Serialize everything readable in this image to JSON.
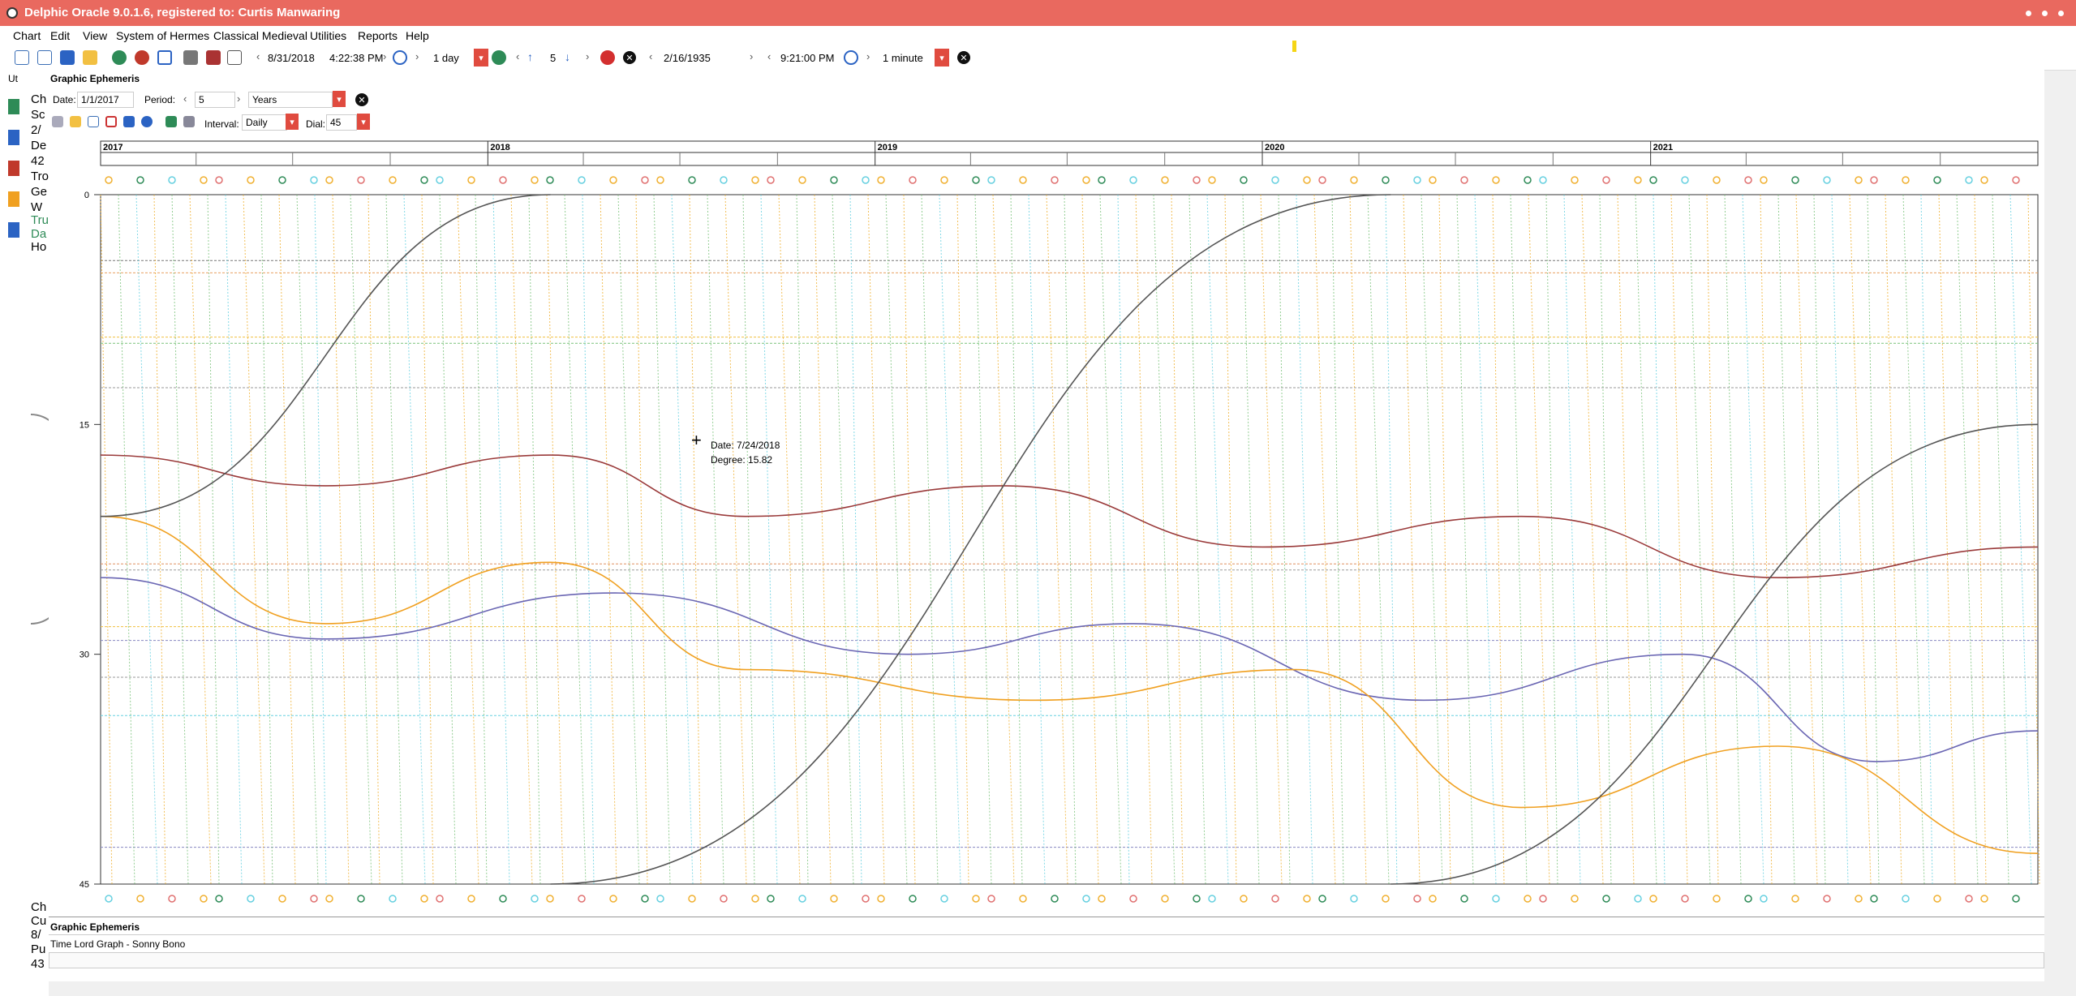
{
  "window": {
    "title": "Delphic Oracle 9.0.1.6, registered to: Curtis Manwaring"
  },
  "menu": [
    "Chart",
    "Edit",
    "View",
    "System of Hermes",
    "Classical Medieval",
    "Utilities",
    "Reports",
    "Help"
  ],
  "toolbar": {
    "date": "8/31/2018",
    "time": "4:22:38 PM",
    "step": "1 day",
    "step_count": "5",
    "date2": "2/16/1935",
    "time2": "9:21:00 PM",
    "step2": "1 minute"
  },
  "ephemeris": {
    "header": "Graphic Ephemeris",
    "date_label": "Date:",
    "date_value": "1/1/2017",
    "period_label": "Period:",
    "period_value": "5",
    "period_unit": "Years",
    "interval_label": "Interval:",
    "interval_value": "Daily",
    "dial_label": "Dial:",
    "dial_value": "45"
  },
  "left_panel_text": [
    "Ut",
    "Ch",
    "Sc",
    "2/",
    "De",
    "42",
    "Tro",
    "Ge",
    "W",
    "Tru",
    "Da",
    "Ho"
  ],
  "left_panel_bottom": [
    "Ch",
    "Cu",
    "8/",
    "Pu",
    "43"
  ],
  "tooltip": {
    "date": "Date: 7/24/2018",
    "degree": "Degree: 15.82"
  },
  "bottom_tabs": {
    "tab1": "Graphic Ephemeris",
    "tab2": "Time Lord Graph - Sonny Bono"
  },
  "chart_data": {
    "type": "line",
    "title": "",
    "x_years": [
      "2017",
      "2018",
      "2019",
      "2020",
      "2021"
    ],
    "x_range": [
      "2017-01-01",
      "2022-01-01"
    ],
    "y_ticks": [
      0,
      15,
      30,
      45
    ],
    "ylim": [
      0,
      45
    ],
    "y_inverted": true,
    "series": [
      {
        "color": "#9a3a3a",
        "x": [
          "2017-01-01",
          "2017-08-01",
          "2018-03-01",
          "2018-09-01",
          "2019-05-01",
          "2020-01-01",
          "2020-09-01",
          "2021-05-01",
          "2022-01-01"
        ],
        "values": [
          17,
          19,
          17,
          21,
          19,
          23,
          21,
          25,
          23
        ]
      },
      {
        "color": "#6a66b3",
        "x": [
          "2017-01-01",
          "2017-08-01",
          "2018-05-01",
          "2019-02-01",
          "2019-09-01",
          "2020-06-01",
          "2021-02-01",
          "2021-08-01",
          "2022-01-01"
        ],
        "values": [
          25,
          29,
          26,
          30,
          28,
          33,
          30,
          37,
          35
        ]
      },
      {
        "color": "#f0a020",
        "x": [
          "2017-01-01",
          "2017-08-01",
          "2018-03-01",
          "2018-09-01",
          "2019-06-01",
          "2020-02-01",
          "2020-09-01",
          "2021-05-01",
          "2022-01-01"
        ],
        "values": [
          21,
          28,
          24,
          31,
          33,
          31,
          40,
          36,
          43
        ]
      },
      {
        "color": "#555555",
        "x": [
          "2017-01-01",
          "2018-03-01"
        ],
        "values": [
          21,
          0
        ]
      },
      {
        "color": "#555555",
        "x": [
          "2018-03-01",
          "2020-05-01"
        ],
        "values": [
          45,
          0
        ]
      },
      {
        "color": "#555555",
        "x": [
          "2020-05-01",
          "2022-01-01"
        ],
        "values": [
          45,
          15
        ]
      }
    ]
  }
}
